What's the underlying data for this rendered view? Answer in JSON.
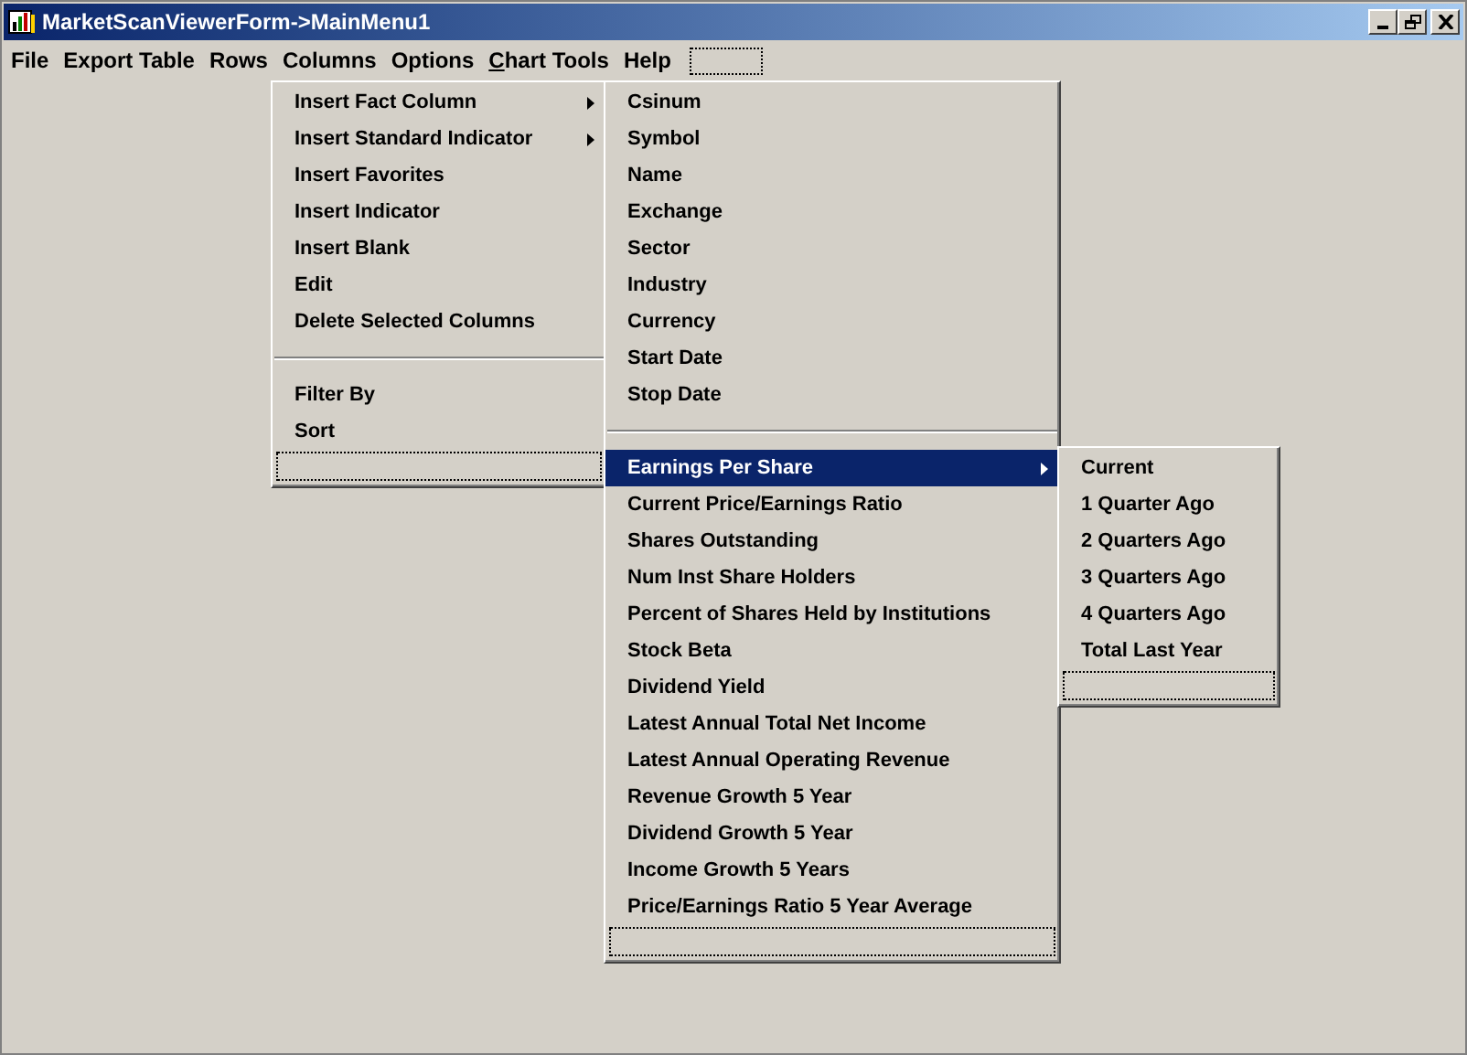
{
  "window": {
    "title": "MarketScanViewerForm->MainMenu1"
  },
  "menu_bar": [
    {
      "label": "File",
      "underline_first": false
    },
    {
      "label": "Export Table",
      "underline_first": false
    },
    {
      "label": "Rows",
      "underline_first": false
    },
    {
      "label": "Columns",
      "underline_first": false
    },
    {
      "label": "Options",
      "underline_first": false
    },
    {
      "label": "Chart Tools",
      "underline_first": true
    },
    {
      "label": "Help",
      "underline_first": false
    },
    {
      "kind": "blank"
    }
  ],
  "menus": [
    {
      "items": [
        {
          "kind": "item",
          "label": "Insert Fact Column",
          "submenu": true,
          "selected": false
        },
        {
          "kind": "item",
          "label": "Insert Standard Indicator",
          "submenu": true,
          "selected": false
        },
        {
          "kind": "item",
          "label": "Insert Favorites",
          "submenu": false,
          "selected": false
        },
        {
          "kind": "item",
          "label": "Insert Indicator",
          "submenu": false,
          "selected": false
        },
        {
          "kind": "item",
          "label": "Insert Blank",
          "submenu": false,
          "selected": false
        },
        {
          "kind": "item",
          "label": "Edit",
          "submenu": false,
          "selected": false
        },
        {
          "kind": "item",
          "label": "Delete Selected Columns",
          "submenu": false,
          "selected": false
        },
        {
          "kind": "separator"
        },
        {
          "kind": "item",
          "label": "Filter By",
          "submenu": false,
          "selected": false
        },
        {
          "kind": "item",
          "label": "Sort",
          "submenu": false,
          "selected": false
        },
        {
          "kind": "blank"
        }
      ]
    },
    {
      "items": [
        {
          "kind": "item",
          "label": "Csinum",
          "submenu": false,
          "selected": false
        },
        {
          "kind": "item",
          "label": "Symbol",
          "submenu": false,
          "selected": false
        },
        {
          "kind": "item",
          "label": "Name",
          "submenu": false,
          "selected": false
        },
        {
          "kind": "item",
          "label": "Exchange",
          "submenu": false,
          "selected": false
        },
        {
          "kind": "item",
          "label": "Sector",
          "submenu": false,
          "selected": false
        },
        {
          "kind": "item",
          "label": "Industry",
          "submenu": false,
          "selected": false
        },
        {
          "kind": "item",
          "label": "Currency",
          "submenu": false,
          "selected": false
        },
        {
          "kind": "item",
          "label": "Start Date",
          "submenu": false,
          "selected": false
        },
        {
          "kind": "item",
          "label": "Stop Date",
          "submenu": false,
          "selected": false
        },
        {
          "kind": "separator"
        },
        {
          "kind": "item",
          "label": "Earnings Per Share",
          "submenu": true,
          "selected": true
        },
        {
          "kind": "item",
          "label": "Current Price/Earnings Ratio",
          "submenu": false,
          "selected": false
        },
        {
          "kind": "item",
          "label": "Shares Outstanding",
          "submenu": false,
          "selected": false
        },
        {
          "kind": "item",
          "label": "Num Inst Share Holders",
          "submenu": false,
          "selected": false
        },
        {
          "kind": "item",
          "label": "Percent of Shares Held by Institutions",
          "submenu": false,
          "selected": false
        },
        {
          "kind": "item",
          "label": "Stock Beta",
          "submenu": false,
          "selected": false
        },
        {
          "kind": "item",
          "label": "Dividend Yield",
          "submenu": false,
          "selected": false
        },
        {
          "kind": "item",
          "label": "Latest Annual Total Net Income",
          "submenu": false,
          "selected": false
        },
        {
          "kind": "item",
          "label": "Latest Annual Operating Revenue",
          "submenu": false,
          "selected": false
        },
        {
          "kind": "item",
          "label": "Revenue Growth 5 Year",
          "submenu": false,
          "selected": false
        },
        {
          "kind": "item",
          "label": "Dividend Growth 5 Year",
          "submenu": false,
          "selected": false
        },
        {
          "kind": "item",
          "label": "Income Growth 5 Years",
          "submenu": false,
          "selected": false
        },
        {
          "kind": "item",
          "label": "Price/Earnings Ratio 5 Year Average",
          "submenu": false,
          "selected": false
        },
        {
          "kind": "blank"
        }
      ]
    },
    {
      "items": [
        {
          "kind": "item",
          "label": "Current",
          "submenu": false,
          "selected": false
        },
        {
          "kind": "item",
          "label": "1 Quarter Ago",
          "submenu": false,
          "selected": false
        },
        {
          "kind": "item",
          "label": "2 Quarters Ago",
          "submenu": false,
          "selected": false
        },
        {
          "kind": "item",
          "label": "3 Quarters Ago",
          "submenu": false,
          "selected": false
        },
        {
          "kind": "item",
          "label": "4 Quarters Ago",
          "submenu": false,
          "selected": false
        },
        {
          "kind": "item",
          "label": "Total Last Year",
          "submenu": false,
          "selected": false
        },
        {
          "kind": "blank"
        }
      ]
    }
  ]
}
